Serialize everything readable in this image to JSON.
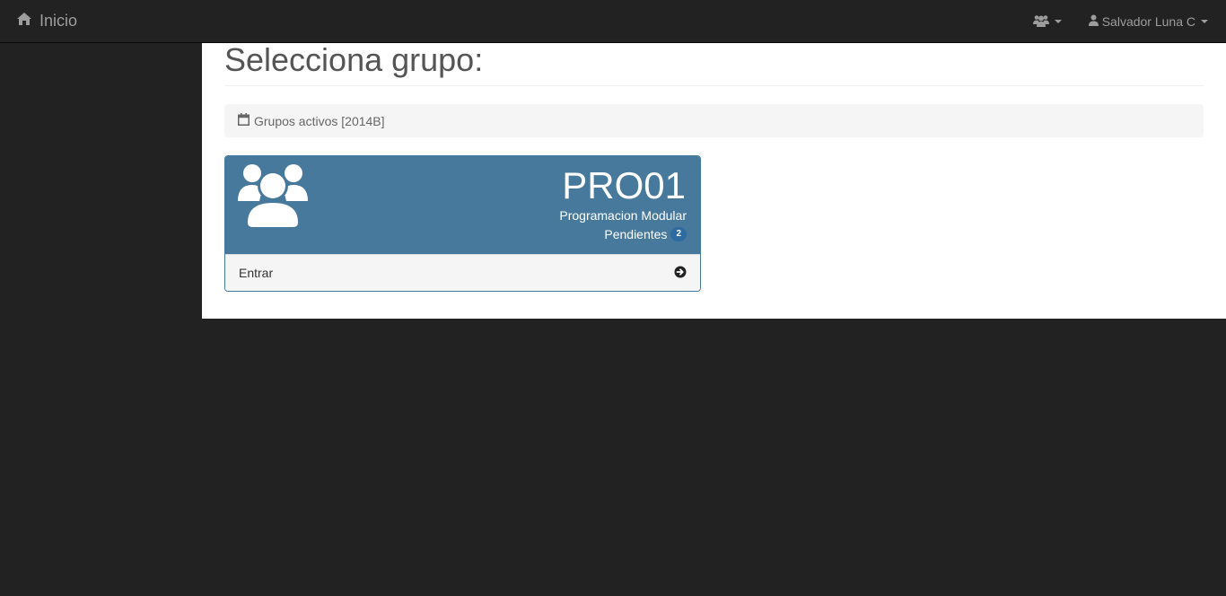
{
  "navbar": {
    "brand_label": "Inicio",
    "brand_icon": "home-icon",
    "groups_icon": "users-icon",
    "user_name": "Salvador Luna C",
    "user_icon": "user-icon"
  },
  "page": {
    "title": "Selecciona grupo:"
  },
  "info": {
    "icon": "calendar-icon",
    "text": "Grupos activos [2014B]"
  },
  "groups": [
    {
      "code": "PRO01",
      "subject": "Programacion Modular",
      "pending_label": "Pendientes",
      "pending_count": "2",
      "enter_label": "Entrar",
      "enter_icon": "arrow-circle-right-icon"
    }
  ],
  "colors": {
    "navbar_bg": "#222222",
    "panel_heading": "#47799c",
    "badge": "#2d6ba0"
  }
}
